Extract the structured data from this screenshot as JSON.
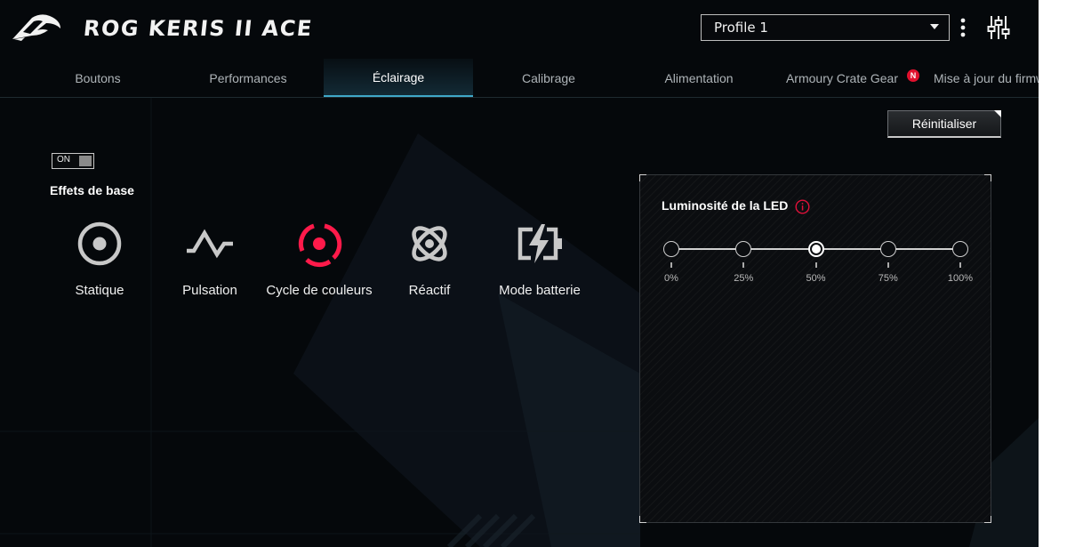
{
  "header": {
    "app_title": "ROG KERIS II ACE",
    "profile": {
      "selected": "Profile 1"
    }
  },
  "tabs": [
    {
      "label": "Boutons",
      "active": false
    },
    {
      "label": "Performances",
      "active": false
    },
    {
      "label": "Éclairage",
      "active": true
    },
    {
      "label": "Calibrage",
      "active": false
    },
    {
      "label": "Alimentation",
      "active": false
    },
    {
      "label": "Armoury Crate Gear",
      "active": false,
      "badge": "N"
    },
    {
      "label": "Mise à jour du firmware",
      "active": false
    }
  ],
  "toolbar": {
    "reset_label": "Réinitialiser"
  },
  "lighting": {
    "toggle_label": "ON",
    "section_title": "Effets de base",
    "effects": [
      {
        "name": "Statique",
        "icon": "static-icon",
        "selected": false
      },
      {
        "name": "Pulsation",
        "icon": "pulse-icon",
        "selected": false
      },
      {
        "name": "Cycle de couleurs",
        "icon": "color-cycle-icon",
        "selected": true
      },
      {
        "name": "Réactif",
        "icon": "reactive-icon",
        "selected": false
      },
      {
        "name": "Mode batterie",
        "icon": "battery-mode-icon",
        "selected": false
      }
    ]
  },
  "brightness": {
    "title": "Luminosité de la LED",
    "options": [
      "0%",
      "25%",
      "50%",
      "75%",
      "100%"
    ],
    "selected_index": 2
  },
  "colors": {
    "accent_red": "#ff1a4a",
    "tab_underline": "#3fa8c8",
    "icon_gray": "#c8c8c8",
    "background": "#05080b"
  }
}
